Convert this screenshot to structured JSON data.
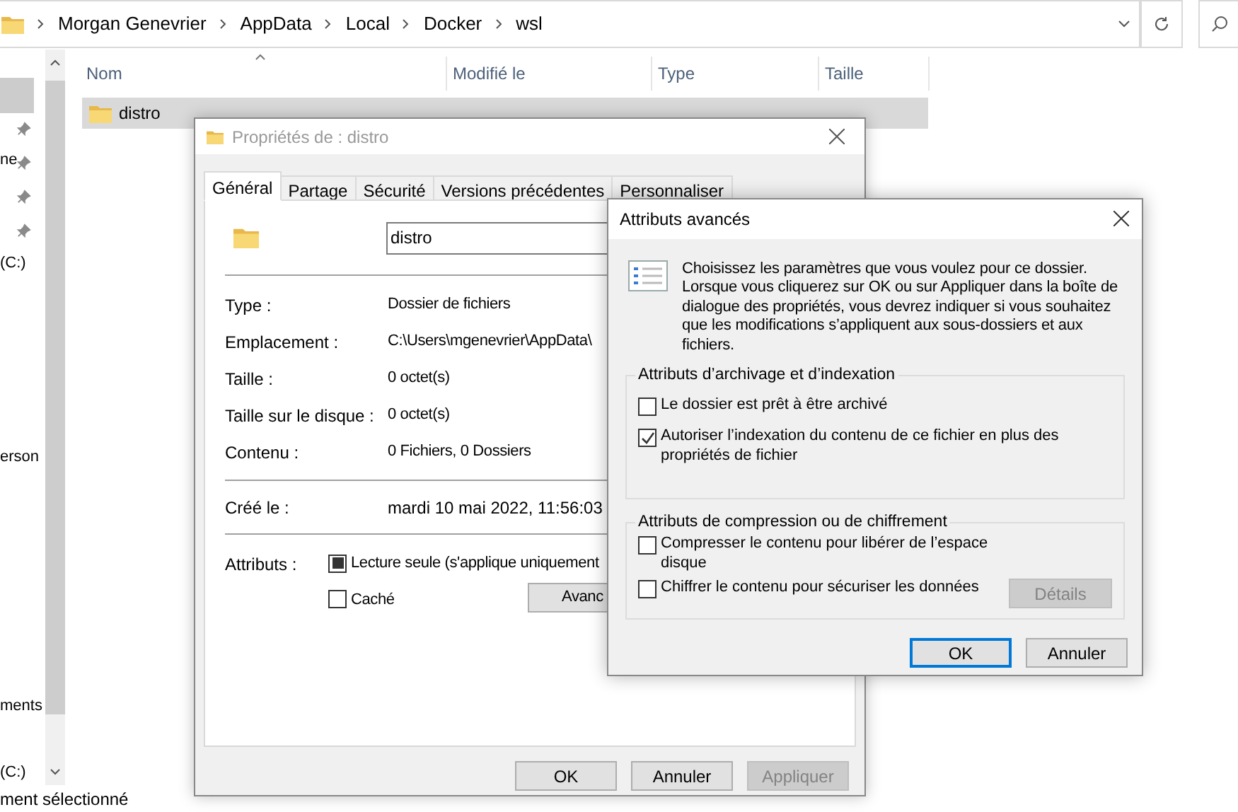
{
  "explorer": {
    "breadcrumb": [
      "Morgan Genevrier",
      "AppData",
      "Local",
      "Docker",
      "wsl"
    ],
    "nav_items": [
      "ne",
      "(C:)",
      "erson",
      "ments",
      "(C:)"
    ],
    "columns": [
      "Nom",
      "Modifié le",
      "Type",
      "Taille"
    ],
    "rows": [
      {
        "name": "distro",
        "selected": true
      }
    ],
    "status_bar": "ment sélectionné"
  },
  "properties": {
    "title": "Propriétés de : distro",
    "tabs": [
      {
        "label": "Général",
        "selected": true
      },
      {
        "label": "Partage",
        "selected": false
      },
      {
        "label": "Sécurité",
        "selected": false
      },
      {
        "label": "Versions précédentes",
        "selected": false
      },
      {
        "label": "Personnaliser",
        "selected": false
      }
    ],
    "name_value": "distro",
    "fields": [
      {
        "label": "Type :",
        "value": "Dossier de fichiers"
      },
      {
        "label": "Emplacement :",
        "value": "C:\\Users\\mgenevrier\\AppData\\"
      },
      {
        "label": "Taille :",
        "value": "0 octet(s)"
      },
      {
        "label": "Taille sur le disque :",
        "value": "0 octet(s)"
      },
      {
        "label": "Contenu :",
        "value": "0 Fichiers, 0 Dossiers"
      }
    ],
    "created": {
      "label": "Créé le :",
      "value": "mardi 10 mai 2022, 11:56:03"
    },
    "attributes_label": "Attributs :",
    "attributes": [
      {
        "label": "Lecture seule (s'applique uniquement",
        "indeterminate": true
      },
      {
        "label": "Caché",
        "indeterminate": false
      }
    ],
    "advanced_button": "Avanc",
    "buttons": [
      {
        "label": "OK",
        "disabled": false
      },
      {
        "label": "Annuler",
        "disabled": false
      },
      {
        "label": "Appliquer",
        "disabled": true
      }
    ]
  },
  "advanced": {
    "title": "Attributs avancés",
    "description": "Choisissez les paramètres que vous voulez pour ce dossier. Lorsque vous cliquerez sur OK ou sur Appliquer dans la boîte de dialogue des propriétés, vous devrez indiquer si vous souhaitez que les modifications s’appliquent aux sous-dossiers et aux fichiers.",
    "groups": [
      {
        "title": "Attributs d’archivage et d’indexation",
        "options": [
          {
            "label": "Le dossier est prêt à être archivé",
            "checked": false
          },
          {
            "label": "Autoriser l’indexation du contenu de ce fichier en plus des propriétés de fichier",
            "checked": true
          }
        ]
      },
      {
        "title": "Attributs de compression ou de chiffrement",
        "options": [
          {
            "label": "Compresser le contenu pour libérer de l’espace disque",
            "checked": false
          },
          {
            "label": "Chiffrer le contenu pour sécuriser les données",
            "checked": false
          }
        ],
        "details_button": {
          "label": "Détails",
          "disabled": true
        }
      }
    ],
    "buttons": [
      {
        "label": "OK",
        "focused": true
      },
      {
        "label": "Annuler",
        "focused": false
      }
    ]
  }
}
